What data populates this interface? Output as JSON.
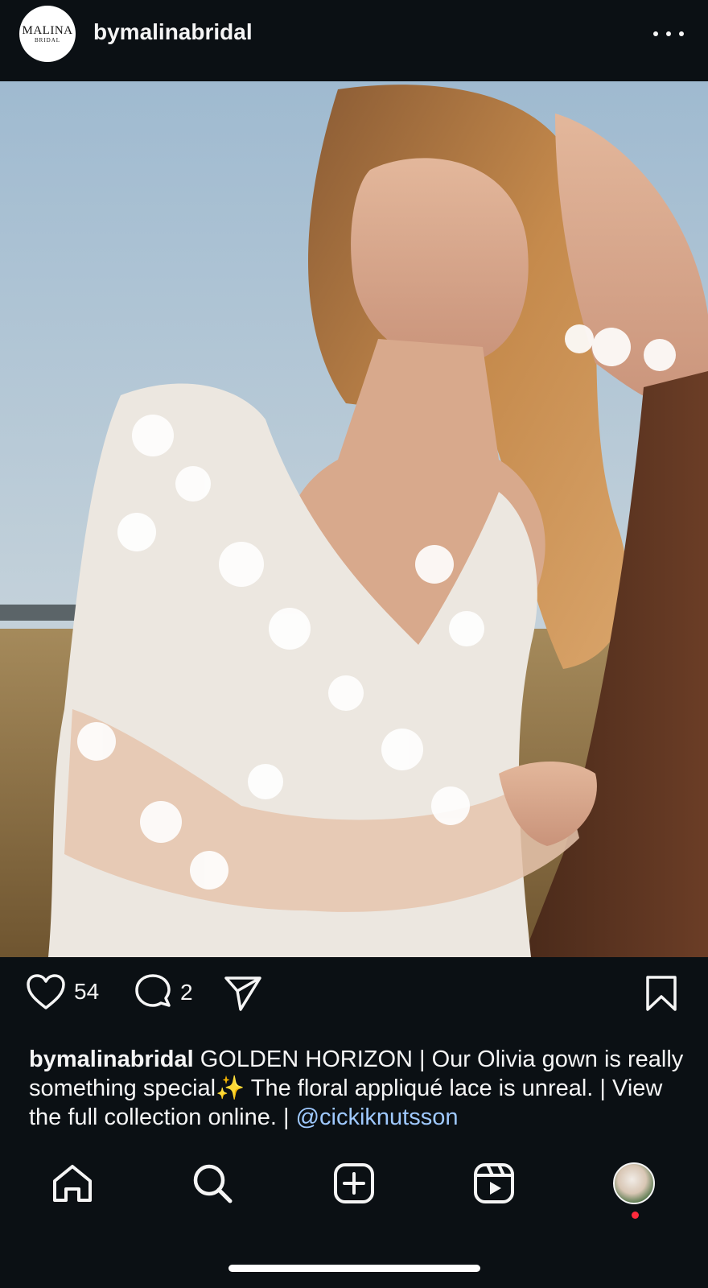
{
  "post": {
    "account": {
      "username": "bymalinabridal",
      "logo_line1": "MALINA",
      "logo_line2": "BRIDAL"
    },
    "more_icon": "more-horizontal-icon",
    "image": {
      "description_icon": "post-photo"
    },
    "actions": {
      "likes": "54",
      "comments": "2",
      "like_icon": "heart-icon",
      "comment_icon": "comment-bubble-icon",
      "share_icon": "paper-plane-icon",
      "save_icon": "bookmark-icon"
    },
    "caption": {
      "username": "bymalinabridal",
      "text": " GOLDEN HORIZON | Our Olivia gown is really something special✨ The floral appliqué lace is unreal. | View the full collection online. | ",
      "mention": "@cickiknutsson"
    }
  },
  "nav": {
    "items": [
      {
        "name": "home",
        "icon": "home-icon"
      },
      {
        "name": "search",
        "icon": "search-icon"
      },
      {
        "name": "create",
        "icon": "plus-square-icon"
      },
      {
        "name": "reels",
        "icon": "reels-icon"
      },
      {
        "name": "profile",
        "icon": "profile-avatar"
      }
    ]
  },
  "colors": {
    "background": "#0b1014",
    "text": "#f5f5f5",
    "mention": "#9fc9ff",
    "notification": "#ff2a3c"
  }
}
